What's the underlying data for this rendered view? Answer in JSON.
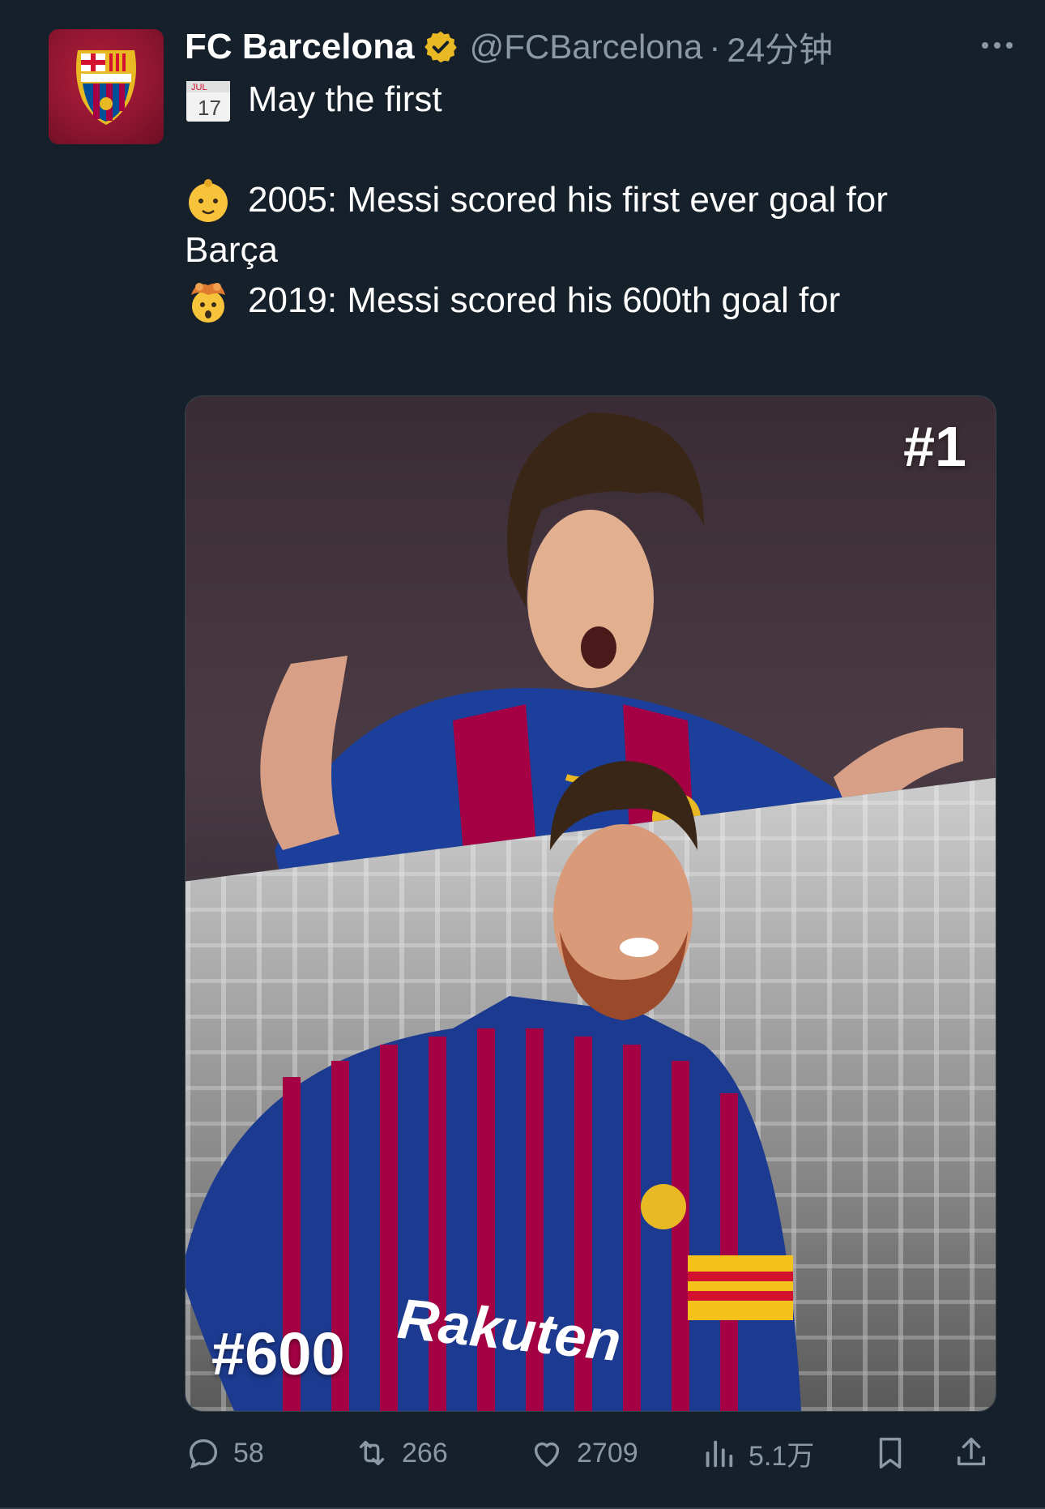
{
  "tweet": {
    "author_name": "FC Barcelona",
    "handle": "@FCBarcelona",
    "separator": "·",
    "time": "24分钟",
    "calendar_month": "JUL",
    "calendar_day": "17",
    "line1": "May the first",
    "line2": "2005: Messi scored his first ever goal for",
    "line3": "Barça",
    "line4": "2019: Messi scored his 600th goal for"
  },
  "media": {
    "top_label": "#1",
    "bottom_label": "#600",
    "sponsor": "Rakuten"
  },
  "actions": {
    "replies": "58",
    "retweets": "266",
    "likes": "2709",
    "views": "5.1万"
  },
  "colors": {
    "background": "#15202b",
    "muted": "#8b98a5",
    "verified": "#e8b923",
    "barca_red": "#a50044",
    "barca_blue": "#004d98"
  },
  "icons": [
    "more-icon",
    "verified-icon",
    "calendar-icon",
    "baby-emoji-icon",
    "exploding-head-emoji-icon",
    "reply-icon",
    "retweet-icon",
    "like-icon",
    "views-icon",
    "bookmark-icon",
    "share-icon"
  ]
}
